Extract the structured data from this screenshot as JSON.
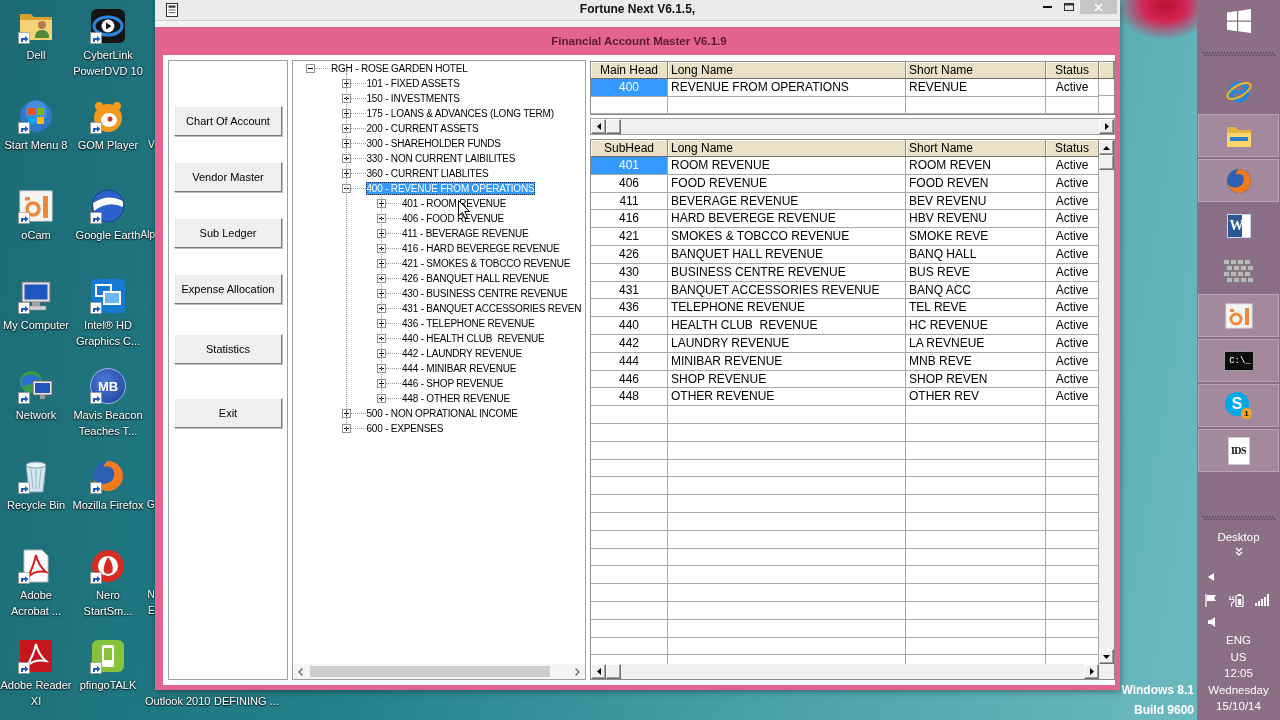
{
  "desktop": {
    "icons": [
      {
        "label": "Dell",
        "kind": "user-folder"
      },
      {
        "label": "Start Menu 8",
        "kind": "orb"
      },
      {
        "label": "oCam",
        "kind": "camera-tile"
      },
      {
        "label": "My Computer",
        "kind": "monitor"
      },
      {
        "label": "Network",
        "kind": "network"
      },
      {
        "label": "Recycle Bin",
        "kind": "bin"
      },
      {
        "label": "Adobe Acrobat ...",
        "kind": "pdf-page"
      },
      {
        "label": "Adobe Reader XI",
        "kind": "pdf-tile"
      },
      {
        "label": "CyberLink PowerDVD 10",
        "kind": "play-tile"
      },
      {
        "label": "GOM Player",
        "kind": "blob"
      },
      {
        "label": "Google Earth",
        "kind": "globe"
      },
      {
        "label": "Intel® HD Graphics C...",
        "kind": "screen-tile"
      },
      {
        "label": "Mavis Beacon Teaches T...",
        "kind": "letter-disc",
        "logo_text": "MB"
      },
      {
        "label": "Mozilla Firefox",
        "kind": "fox"
      },
      {
        "label": "Nero StartSm...",
        "kind": "flame-disc"
      },
      {
        "label": "pfingoTALK",
        "kind": "phone-tile"
      }
    ],
    "cut_labels": [
      "V",
      "Alp",
      "G",
      "N",
      "E",
      "Outlook 2010",
      "DEFINING ..."
    ],
    "os_watermark": {
      "edition": "Windows 8.1",
      "build": "Build 9600"
    }
  },
  "app_window": {
    "title": "Fortune Next V6.1.5,",
    "form": {
      "title": "Financial Account Master V6.1.9",
      "buttons": [
        "Chart Of Account",
        "Vendor Master",
        "Sub Ledger",
        "Expense Allocation",
        "Statistics",
        "Exit"
      ],
      "tree": {
        "label": "RGH - ROSE GARDEN HOTEL",
        "expanded": true,
        "selected": false,
        "children": [
          {
            "label": "101 - FIXED ASSETS",
            "expanded": false,
            "selected": false
          },
          {
            "label": "150 - INVESTMENTS",
            "expanded": false,
            "selected": false
          },
          {
            "label": "175 - LOANS & ADVANCES (LONG TERM)",
            "expanded": false,
            "selected": false
          },
          {
            "label": "200 - CURRENT ASSETS",
            "expanded": false,
            "selected": false
          },
          {
            "label": "300 - SHAREHOLDER FUNDS",
            "expanded": false,
            "selected": false
          },
          {
            "label": "330 - NON CURRENT LAIBILITES",
            "expanded": false,
            "selected": false
          },
          {
            "label": "360 - CURRENT LIABLITES",
            "expanded": false,
            "selected": false
          },
          {
            "label": "400 - REVENUE FROM OPERATIONS",
            "expanded": true,
            "selected": true,
            "children": [
              {
                "label": "401 - ROOM REVENUE",
                "expanded": false,
                "selected": false
              },
              {
                "label": "406 - FOOD REVENUE",
                "expanded": false,
                "selected": false
              },
              {
                "label": "411 - BEVERAGE REVENUE",
                "expanded": false,
                "selected": false
              },
              {
                "label": "416 - HARD BEVEREGE REVENUE",
                "expanded": false,
                "selected": false
              },
              {
                "label": "421 - SMOKES & TOBCCO REVENUE",
                "expanded": false,
                "selected": false
              },
              {
                "label": "426 - BANQUET HALL REVENUE",
                "expanded": false,
                "selected": false
              },
              {
                "label": "430 - BUSINESS CENTRE REVENUE",
                "expanded": false,
                "selected": false
              },
              {
                "label": "431 - BANQUET ACCESSORIES REVEN",
                "expanded": false,
                "selected": false
              },
              {
                "label": "436 - TELEPHONE REVENUE",
                "expanded": false,
                "selected": false
              },
              {
                "label": "440 - HEALTH CLUB  REVENUE",
                "expanded": false,
                "selected": false
              },
              {
                "label": "442 - LAUNDRY REVENUE",
                "expanded": false,
                "selected": false
              },
              {
                "label": "444 - MINIBAR REVENUE",
                "expanded": false,
                "selected": false
              },
              {
                "label": "446 - SHOP REVENUE",
                "expanded": false,
                "selected": false
              },
              {
                "label": "448 - OTHER REVENUE",
                "expanded": false,
                "selected": false
              }
            ]
          },
          {
            "label": "500 - NON OPRATIONAL INCOME",
            "expanded": false,
            "selected": false
          },
          {
            "label": "600 - EXPENSES",
            "expanded": false,
            "selected": false
          }
        ]
      },
      "head_grid": {
        "columns": [
          "Main Head",
          "Long Name",
          "Short Name",
          "Status"
        ],
        "rows": [
          {
            "cells": [
              "400",
              "REVENUE FROM OPERATIONS",
              "REVENUE",
              "Active"
            ],
            "selected": true
          }
        ]
      },
      "subhead_grid": {
        "columns": [
          "SubHead",
          "Long Name",
          "Short Name",
          "Status"
        ],
        "rows": [
          {
            "cells": [
              "401",
              "ROOM REVENUE",
              "ROOM REVEN",
              "Active"
            ],
            "selected": true
          },
          {
            "cells": [
              "406",
              "FOOD REVENUE",
              "FOOD REVEN",
              "Active"
            ],
            "selected": false
          },
          {
            "cells": [
              "411",
              "BEVERAGE REVENUE",
              "BEV REVENU",
              "Active"
            ],
            "selected": false
          },
          {
            "cells": [
              "416",
              "HARD BEVEREGE REVENUE",
              "HBV REVENU",
              "Active"
            ],
            "selected": false
          },
          {
            "cells": [
              "421",
              "SMOKES & TOBCCO REVENUE",
              "SMOKE REVE",
              "Active"
            ],
            "selected": false
          },
          {
            "cells": [
              "426",
              "BANQUET HALL REVENUE",
              "BANQ HALL",
              "Active"
            ],
            "selected": false
          },
          {
            "cells": [
              "430",
              "BUSINESS CENTRE REVENUE",
              "BUS REVE",
              "Active"
            ],
            "selected": false
          },
          {
            "cells": [
              "431",
              "BANQUET ACCESSORIES REVENUE",
              "BANQ ACC",
              "Active"
            ],
            "selected": false
          },
          {
            "cells": [
              "436",
              "TELEPHONE REVENUE",
              "TEL REVE",
              "Active"
            ],
            "selected": false
          },
          {
            "cells": [
              "440",
              "HEALTH CLUB  REVENUE",
              "HC REVENUE",
              "Active"
            ],
            "selected": false
          },
          {
            "cells": [
              "442",
              "LAUNDRY REVENUE",
              "LA REVNEUE",
              "Active"
            ],
            "selected": false
          },
          {
            "cells": [
              "444",
              "MINIBAR REVENUE",
              "MNB REVE",
              "Active"
            ],
            "selected": false
          },
          {
            "cells": [
              "446",
              "SHOP REVENUE",
              "SHOP REVEN",
              "Active"
            ],
            "selected": false
          },
          {
            "cells": [
              "448",
              "OTHER REVENUE",
              "OTHER REV",
              "Active"
            ],
            "selected": false
          }
        ]
      }
    }
  },
  "taskbar": {
    "apps": [
      {
        "kind": "e-logo",
        "open": false
      },
      {
        "kind": "folder",
        "open": true
      },
      {
        "kind": "fox",
        "open": true
      },
      {
        "kind": "doc-letter",
        "logo_text": "W",
        "open": false
      },
      {
        "kind": "bricks",
        "open": false
      },
      {
        "kind": "camera",
        "open": true
      },
      {
        "kind": "console",
        "logo_text": "C:\\_",
        "open": true
      },
      {
        "kind": "chat",
        "logo_text": "S",
        "badge": "1",
        "open": true
      },
      {
        "kind": "tile-letters",
        "logo_text": "IDS",
        "open": true
      }
    ],
    "toolbar_label": "Desktop",
    "clock": {
      "language": "ENG",
      "region": "US",
      "time": "12:05",
      "day": "Wednesday",
      "date": "15/10/14"
    }
  }
}
